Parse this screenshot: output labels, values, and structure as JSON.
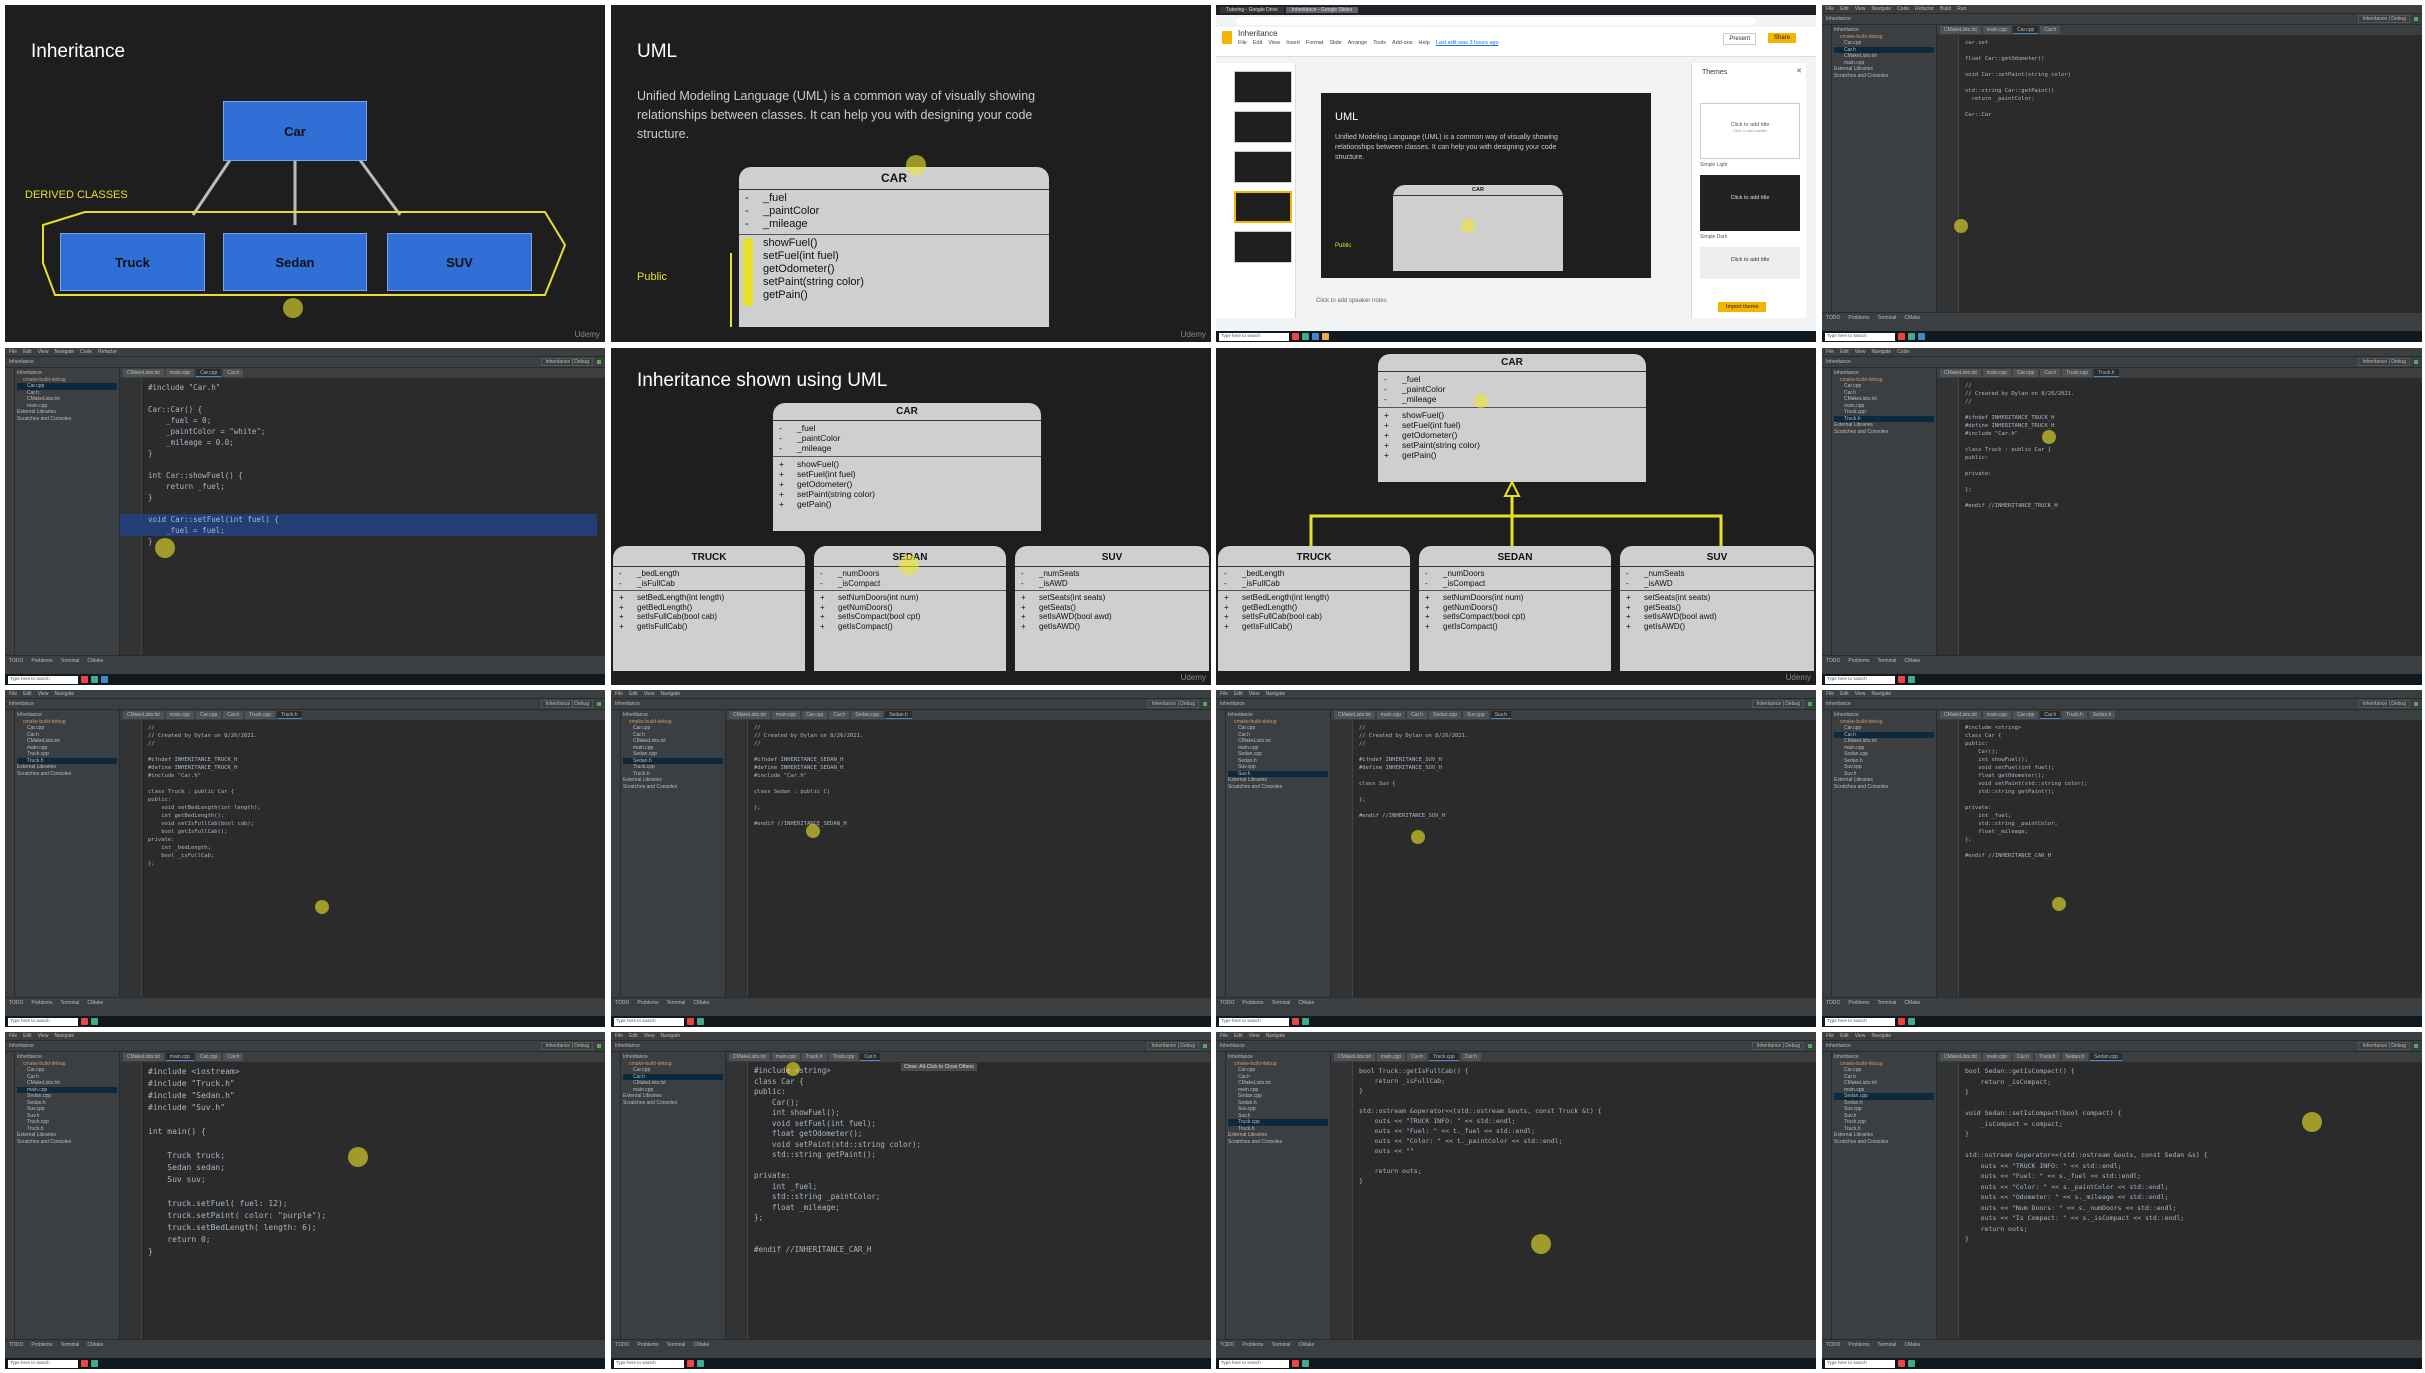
{
  "slide_inheritance": {
    "title": "Inheritance",
    "base": "Car",
    "derived_label": "DERIVED CLASSES",
    "derived": [
      "Truck",
      "Sedan",
      "SUV"
    ],
    "watermark": "Udemy"
  },
  "slide_uml": {
    "title": "UML",
    "body": "Unified Modeling Language (UML) is a common way of visually showing relationships between classes. It can help you with designing your code structure.",
    "public_label": "Public",
    "class_name": "CAR",
    "fields": [
      "_fuel",
      "_paintColor",
      "_mileage"
    ],
    "methods": [
      "showFuel()",
      "setFuel(int fuel)",
      "getOdometer()",
      "setPaint(string color)",
      "getPain()"
    ],
    "watermark": "Udemy"
  },
  "browser": {
    "tabs": [
      "Tutoring - Google Drive",
      "Inheritance - Google Slides"
    ],
    "doc_title": "Inheritance",
    "menu": [
      "File",
      "Edit",
      "View",
      "Insert",
      "Format",
      "Slide",
      "Arrange",
      "Tools",
      "Add-ons",
      "Help"
    ],
    "last_edit": "Last edit was 3 hours ago",
    "present": "Present",
    "share": "Share",
    "themes_title": "Themes",
    "themes": [
      "Simple Light",
      "Simple Dark"
    ],
    "theme_placeholder": "Click to add title",
    "theme_sub": "Click to add subtitle",
    "import": "Import theme",
    "speaker_notes": "Click to add speaker notes"
  },
  "ide_labels": {
    "project": "Inheritance",
    "config": "Inheritance | Debug",
    "menu": [
      "File",
      "Edit",
      "View",
      "Navigate",
      "Code",
      "Refactor",
      "Build",
      "Run",
      "Tools",
      "VCS",
      "Window",
      "Help"
    ],
    "tools": [
      "TODO",
      "Problems",
      "Terminal",
      "CMake"
    ],
    "taskbar_search": "Type here to search",
    "tree": [
      "Inheritance",
      "cmake-build-debug",
      "Car.cpp",
      "Car.h",
      "CMakeLists.txt",
      "main.cpp",
      "Sedan.cpp",
      "Sedan.h",
      "Suv.cpp",
      "Suv.h",
      "Truck.cpp",
      "Truck.h",
      "External Libraries",
      "Scratches and Consoles"
    ]
  },
  "slide_inh_uml": {
    "title": "Inheritance shown using UML",
    "car": {
      "name": "CAR",
      "fields": [
        "_fuel",
        "_paintColor",
        "_mileage"
      ],
      "methods": [
        "showFuel()",
        "setFuel(int fuel)",
        "getOdometer()",
        "setPaint(string color)",
        "getPain()"
      ]
    },
    "truck": {
      "name": "TRUCK",
      "fields": [
        "_bedLength",
        "_isFullCab"
      ],
      "methods": [
        "setBedLength(int length)",
        "getBedLength()",
        "setIsFullCab(bool cab)",
        "getIsFullCab()"
      ]
    },
    "sedan": {
      "name": "SEDAN",
      "fields": [
        "_numDoors",
        "_isCompact"
      ],
      "methods": [
        "setNumDoors(int num)",
        "getNumDoors()",
        "setIsCompact(bool cpt)",
        "getIsCompact()"
      ]
    },
    "suv": {
      "name": "SUV",
      "fields": [
        "_numSeats",
        "_isAWD"
      ],
      "methods": [
        "setSeats(int seats)",
        "getSeats()",
        "setIsAWD(bool awd)",
        "getIsAWD()"
      ]
    },
    "watermark": "Udemy"
  },
  "code": {
    "t4": "car.set\n\nfloat Car::getOdometer()\n\nvoid Car::setPaint(string color)\n\nstd::string Car::getPaint()\n  return _paintColor;\n\nCar::Car",
    "t5": "#include \"Car.h\"\n\nCar::Car() {\n    _fuel = 0;\n    _paintColor = \"white\";\n    _mileage = 0.0;\n}\n\nint Car::showFuel() {\n    return _fuel;\n}\n\nvoid Car::setFuel(int fuel) {\n    _fuel = fuel;\n}",
    "t8": "//\n// Created by Dylan on 8/26/2021.\n//\n\n#ifndef INHERITANCE_TRUCK_H\n#define INHERITANCE_TRUCK_H\n#include \"Car.h\"\n\nclass Truck : public Car {\npublic:\n\nprivate:\n\n};\n\n#endif //INHERITANCE_TRUCK_H",
    "t9": "//\n// Created by Dylan on 8/26/2021.\n//\n\n#ifndef INHERITANCE_TRUCK_H\n#define INHERITANCE_TRUCK_H\n#include \"Car.h\"\n\nclass Truck : public Car {\npublic:\n    void setBedLength(int length);\n    int getBedLength();\n    void setIsFullCab(bool cab);\n    bool getIsFullCab();\nprivate:\n    int _bedLength;\n    bool _isFullCab;\n};",
    "t10": "//\n// Created by Dylan on 8/26/2021.\n//\n\n#ifndef INHERITANCE_SEDAN_H\n#define INHERITANCE_SEDAN_H\n#include \"Car.h\"\n\nclass Sedan : public C|\n\n};\n\n#endif //INHERITANCE_SEDAN_H",
    "t11": "//\n// Created by Dylan on 8/26/2021.\n//\n\n#ifndef INHERITANCE_SUV_H\n#define INHERITANCE_SUV_H\n\nclass Suv {\n\n};\n\n#endif //INHERITANCE_SUV_H",
    "t12": "#include <string>\nclass Car {\npublic:\n    Car();\n    int showFuel();\n    void setFuel(int fuel);\n    float getOdometer();\n    void setPaint(std::string color);\n    std::string getPaint();\n\nprivate:\n    int _fuel;\n    std::string _paintColor;\n    float _mileage;\n};\n\n#endif //INHERITANCE_CAR_H",
    "t13": "#include <iostream>\n#include \"Truck.h\"\n#include \"Sedan.h\"\n#include \"Suv.h\"\n\nint main() {\n\n    Truck truck;\n    Sedan sedan;\n    Suv suv;\n\n    truck.setFuel( fuel: 12);\n    truck.setPaint( color: \"purple\");\n    truck.setBedLength( length: 6);\n    return 0;\n}",
    "t14": "#include <string>\nclass Car {\npublic:\n    Car();\n    int showFuel();\n    void setFuel(int fuel);\n    float getOdometer();\n    void setPaint(std::string color);\n    std::string getPaint();\n\nprivate:\n    int _fuel;\n    std::string _paintColor;\n    float _mileage;\n};\n\n\n#endif //INHERITANCE_CAR_H",
    "t15": "bool Truck::getIsFullCab() {\n    return _isFullCab;\n}\n\nstd::ostream &operator<<(std::ostream &outs, const Truck &t) {\n    outs << \"TRUCK INFO: \" << std::endl;\n    outs << \"Fuel: \" << t._fuel << std::endl;\n    outs << \"Color: \" << t._paintColor << std::endl;\n    outs << \"\"\n\n    return outs;\n}",
    "t16": "bool Sedan::getIsCompact() {\n    return _isCompact;\n}\n\nvoid Sedan::setIsCompact(bool compact) {\n    _isCompact = compact;\n}\n\nstd::ostream &operator<<(std::ostream &outs, const Sedan &s) {\n    outs << \"TRUCK INFO: \" << std::endl;\n    outs << \"Fuel: \" << s._fuel << std::endl;\n    outs << \"Color: \" << s._paintColor << std::endl;\n    outs << \"Odometer: \" << s._mileage << std::endl;\n    outs << \"Num Doors: \" << s._numDoors << std::endl;\n    outs << \"Is Compact: \" << s._isCompact << std::endl;\n    return outs;\n}"
  },
  "tabs": {
    "t4": [
      "CMakeLists.txt",
      "main.cpp",
      "Car.cpp",
      "Car.h"
    ],
    "t5": [
      "CMakeLists.txt",
      "main.cpp",
      "Car.cpp",
      "Car.h"
    ],
    "t8": [
      "CMakeLists.txt",
      "main.cpp",
      "Car.cpp",
      "Car.h",
      "Truck.cpp",
      "Truck.h"
    ],
    "t9": [
      "CMakeLists.txt",
      "main.cpp",
      "Car.cpp",
      "Car.h",
      "Truck.cpp",
      "Truck.h"
    ],
    "t10": [
      "CMakeLists.txt",
      "main.cpp",
      "Car.cpp",
      "Car.h",
      "Sedan.cpp",
      "Sedan.h"
    ],
    "t11": [
      "CMakeLists.txt",
      "main.cpp",
      "Car.h",
      "Sedan.cpp",
      "Suv.cpp",
      "Suv.h"
    ],
    "t12": [
      "CMakeLists.txt",
      "main.cpp",
      "Car.cpp",
      "Car.h",
      "Truck.h",
      "Sedan.h"
    ],
    "t13": [
      "CMakeLists.txt",
      "main.cpp",
      "Car.cpp",
      "Car.h"
    ],
    "t14": [
      "CMakeLists.txt",
      "main.cpp",
      "Truck.h",
      "Truck.cpp",
      "Car.h"
    ],
    "t15": [
      "CMakeLists.txt",
      "main.cpp",
      "Car.h",
      "Truck.cpp",
      "Car.h"
    ],
    "t16": [
      "CMakeLists.txt",
      "main.cpp",
      "Car.h",
      "Truck.h",
      "Sedan.h",
      "Sedan.cpp"
    ]
  },
  "tooltip": "Close. Alt-Click to Close Others"
}
